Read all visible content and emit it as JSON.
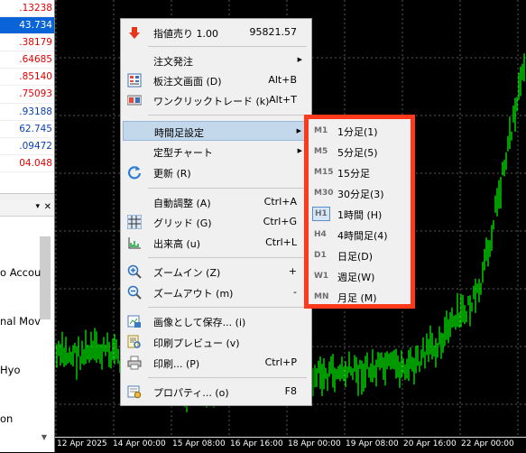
{
  "market_watch": {
    "prices": [
      ".13238",
      "43.734",
      ".38179",
      ".64685",
      ".85140",
      ".75093",
      ".93188",
      "62.745",
      ".09472",
      "04.048"
    ],
    "highlighted_index": 1
  },
  "navigator": {
    "items": [
      "o Accou",
      "nal Mov",
      "Hyo",
      "on"
    ]
  },
  "time_axis": {
    "ticks": [
      "12 Apr 2025",
      "14 Apr 00:00",
      "15 Apr 08:00",
      "16 Apr 16:00",
      "18 Apr 00:00",
      "19 Apr 08:00",
      "20 Apr 16:00",
      "22 Apr 00:00"
    ]
  },
  "context_menu": {
    "items": [
      {
        "label": "指値売り 1.00",
        "shortcut": "95821.57",
        "icon": "sell-limit-icon"
      },
      {
        "label": "注文発注",
        "shortcut": "",
        "submenu": true
      },
      {
        "label": "板注文画面 (D)",
        "shortcut": "Alt+B",
        "icon": "order-book-icon"
      },
      {
        "label": "ワンクリックトレード (k)",
        "shortcut": "Alt+T",
        "icon": "one-click-trade-icon"
      },
      {
        "label": "時間足設定",
        "shortcut": "",
        "submenu": true,
        "highlighted": true
      },
      {
        "label": "定型チャート",
        "shortcut": "",
        "submenu": true
      },
      {
        "label": "更新 (R)",
        "shortcut": "",
        "icon": "refresh-icon"
      },
      {
        "label": "自動調整 (A)",
        "shortcut": "Ctrl+A"
      },
      {
        "label": "グリッド (G)",
        "shortcut": "Ctrl+G",
        "icon": "grid-icon"
      },
      {
        "label": "出来高 (u)",
        "shortcut": "Ctrl+L",
        "icon": "volume-icon"
      },
      {
        "label": "ズームイン (Z)",
        "shortcut": "+",
        "icon": "zoom-in-icon"
      },
      {
        "label": "ズームアウト (m)",
        "shortcut": "-",
        "icon": "zoom-out-icon"
      },
      {
        "label": "画像として保存... (i)",
        "shortcut": "",
        "icon": "save-image-icon"
      },
      {
        "label": "印刷プレビュー (v)",
        "shortcut": "",
        "icon": "print-preview-icon"
      },
      {
        "label": "印刷... (P)",
        "shortcut": "Ctrl+P",
        "icon": "print-icon"
      },
      {
        "label": "プロパティ... (o)",
        "shortcut": "F8",
        "icon": "properties-icon"
      }
    ]
  },
  "timeframe_submenu": {
    "items": [
      {
        "code": "M1",
        "label": "1分足(1)"
      },
      {
        "code": "M5",
        "label": "5分足(5)"
      },
      {
        "code": "M15",
        "label": "15分足"
      },
      {
        "code": "M30",
        "label": "30分足(3)"
      },
      {
        "code": "H1",
        "label": "1時間 (H)",
        "selected": true
      },
      {
        "code": "H4",
        "label": "4時間足(4)"
      },
      {
        "code": "D1",
        "label": "日足(D)"
      },
      {
        "code": "W1",
        "label": "週足(W)"
      },
      {
        "code": "MN",
        "label": "月足 (M)"
      }
    ],
    "highlight_color": "#ff3a1c"
  },
  "colors": {
    "chart_background": "#000000",
    "candles": "#00ff00",
    "grid": "#5a5a5a",
    "price_negative": "#e00000",
    "price_positive": "#0a3fb8"
  }
}
